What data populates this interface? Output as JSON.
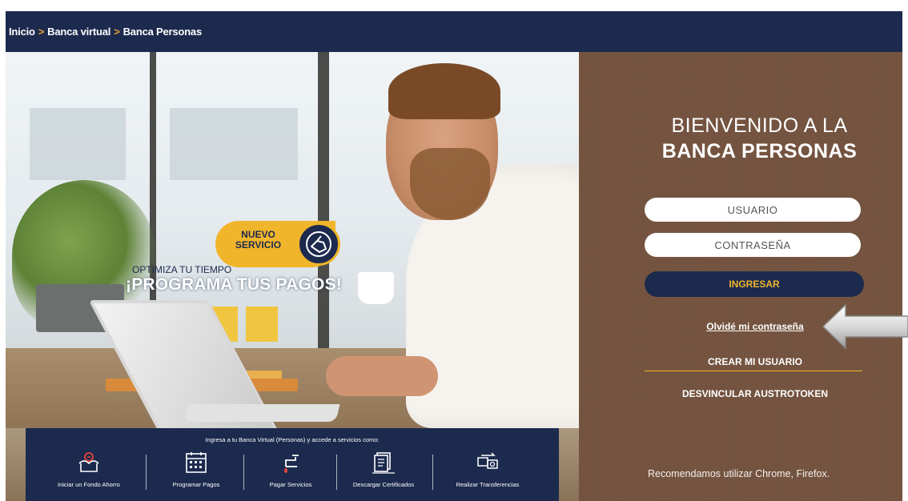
{
  "breadcrumb": {
    "items": [
      "Inicio",
      "Banca virtual",
      "Banca Personas"
    ],
    "separator": ">"
  },
  "promo": {
    "badge": "NUEVO SERVICIO",
    "subtitle": "OPTIMIZA TU TIEMPO",
    "title": "¡PROGRAMA TUS PAGOS!"
  },
  "login": {
    "welcome_line1": "BIENVENIDO A LA",
    "welcome_line2": "BANCA PERSONAS",
    "username_placeholder": "USUARIO",
    "password_placeholder": "CONTRASEÑA",
    "submit_label": "INGRESAR",
    "forgot_label": "Olvidé mi contraseña",
    "create_label": "CREAR MI USUARIO",
    "unlink_label": "DESVINCULAR AUSTROTOKEN",
    "browser_note": "Recomendamos utilizar Chrome, Firefox."
  },
  "services": {
    "intro": "Ingresa a tu Banca Virtual (Personas) y accede a servicios como:",
    "items": [
      {
        "label": "Iniciar un Fondo Ahorro",
        "icon": "savings-icon"
      },
      {
        "label": "Programar Pagos",
        "icon": "calendar-icon"
      },
      {
        "label": "Pagar Servicios",
        "icon": "faucet-icon"
      },
      {
        "label": "Descargar Certificados",
        "icon": "certificate-icon"
      },
      {
        "label": "Realizar Transferencias",
        "icon": "transfer-icon"
      }
    ]
  },
  "colors": {
    "navy": "#1c2a4e",
    "gold": "#f1b52b",
    "panel_brown": "#745440"
  }
}
